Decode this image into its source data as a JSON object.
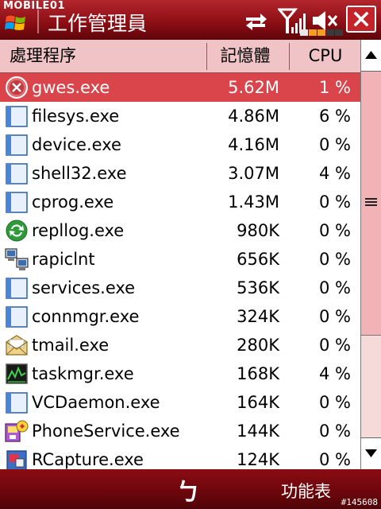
{
  "watermark": "MOBILE01",
  "title": "工作管理員",
  "header": {
    "process": "處理程序",
    "memory": "記憶體",
    "cpu": "CPU"
  },
  "processes": [
    {
      "name": "gwes.exe",
      "mem": "5.62M",
      "cpu": "1 %",
      "icon": "stop-icon",
      "selected": true
    },
    {
      "name": "filesys.exe",
      "mem": "4.86M",
      "cpu": "6 %",
      "icon": "window-icon"
    },
    {
      "name": "device.exe",
      "mem": "4.16M",
      "cpu": "0 %",
      "icon": "window-icon"
    },
    {
      "name": "shell32.exe",
      "mem": "3.07M",
      "cpu": "4 %",
      "icon": "window-icon"
    },
    {
      "name": "cprog.exe",
      "mem": "1.43M",
      "cpu": "0 %",
      "icon": "window-icon"
    },
    {
      "name": "repllog.exe",
      "mem": "980K",
      "cpu": "0 %",
      "icon": "sync-icon"
    },
    {
      "name": "rapiclnt",
      "mem": "656K",
      "cpu": "0 %",
      "icon": "computers-icon"
    },
    {
      "name": "services.exe",
      "mem": "536K",
      "cpu": "0 %",
      "icon": "window-icon"
    },
    {
      "name": "connmgr.exe",
      "mem": "324K",
      "cpu": "0 %",
      "icon": "window-icon"
    },
    {
      "name": "tmail.exe",
      "mem": "280K",
      "cpu": "0 %",
      "icon": "mail-icon"
    },
    {
      "name": "taskmgr.exe",
      "mem": "168K",
      "cpu": "4 %",
      "icon": "activity-monitor-icon"
    },
    {
      "name": "VCDaemon.exe",
      "mem": "164K",
      "cpu": "0 %",
      "icon": "window-icon"
    },
    {
      "name": "PhoneService.exe",
      "mem": "144K",
      "cpu": "0 %",
      "icon": "phone-service-icon"
    },
    {
      "name": "RCapture.exe",
      "mem": "124K",
      "cpu": "0 %",
      "icon": "capture-icon"
    }
  ],
  "softkeys": {
    "left": "ㄅ",
    "right": "功能表"
  },
  "corner_id": "#145608",
  "colors": {
    "accent": "#9c1a20",
    "selected_row": "#d9454a",
    "header_bg": "#f0c4c6"
  }
}
